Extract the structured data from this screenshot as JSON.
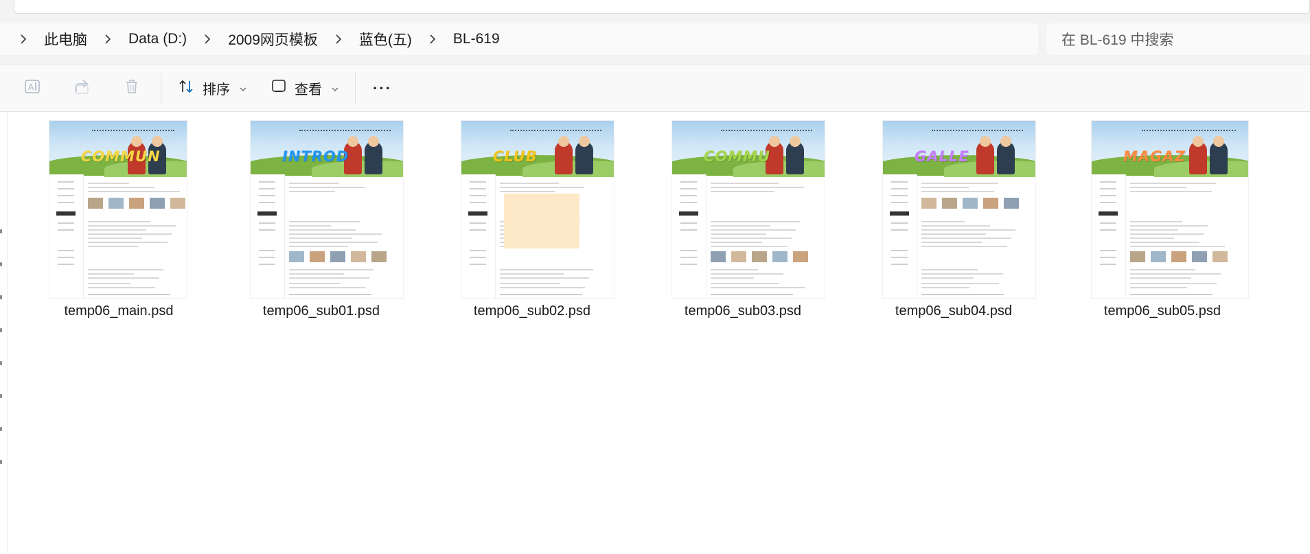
{
  "breadcrumb": {
    "items": [
      "此电脑",
      "Data (D:)",
      "2009网页模板",
      "蓝色(五)",
      "BL-619"
    ]
  },
  "search": {
    "placeholder": "在 BL-619 中搜索"
  },
  "toolbar": {
    "rename_icon": "rename-icon",
    "share_icon": "share-icon",
    "delete_icon": "delete-icon",
    "sort_label": "排序",
    "view_label": "查看",
    "more_label": "···"
  },
  "files": [
    {
      "name": "temp06_main.psd",
      "thumb_word": "COMMUN",
      "word_color": "#f6d743"
    },
    {
      "name": "temp06_sub01.psd",
      "thumb_word": "INTROD",
      "word_color": "#2196f3"
    },
    {
      "name": "temp06_sub02.psd",
      "thumb_word": "CLUB",
      "word_color": "#f5c518"
    },
    {
      "name": "temp06_sub03.psd",
      "thumb_word": "COMMU",
      "word_color": "#a5d64a"
    },
    {
      "name": "temp06_sub04.psd",
      "thumb_word": "GALLE",
      "word_color": "#c77dff"
    },
    {
      "name": "temp06_sub05.psd",
      "thumb_word": "MAGAZ",
      "word_color": "#ff8a3d"
    }
  ],
  "colors": {
    "accent": "#0067c0",
    "chrome_bg": "#f3f3f3"
  }
}
